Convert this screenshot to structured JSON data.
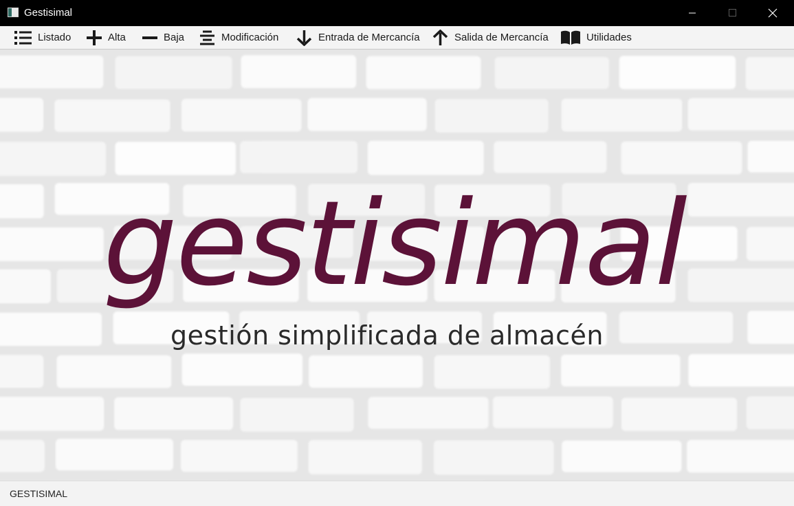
{
  "window": {
    "title": "Gestisimal",
    "minimize_icon": "minimize-icon",
    "maximize_icon": "maximize-icon",
    "close_icon": "close-icon"
  },
  "menu": {
    "items": [
      {
        "label": "Listado",
        "icon": "list-icon"
      },
      {
        "label": "Alta",
        "icon": "plus-icon"
      },
      {
        "label": "Baja",
        "icon": "minus-icon"
      },
      {
        "label": "Modificación",
        "icon": "align-center-icon"
      },
      {
        "label": "Entrada de Mercancía",
        "icon": "arrow-down-icon"
      },
      {
        "label": "Salida de Mercancía",
        "icon": "arrow-up-icon"
      },
      {
        "label": "Utilidades",
        "icon": "book-icon"
      }
    ]
  },
  "main": {
    "logo_text": "gestisimal",
    "tagline": "gestión simplificada de almacén",
    "background": "white-brick-wall",
    "logo_color": "#5c1238"
  },
  "status": {
    "text": "GESTISIMAL"
  },
  "colors": {
    "titlebar": "#000000",
    "menubar": "#f4f4f4",
    "statusbar": "#f3f3f3"
  }
}
